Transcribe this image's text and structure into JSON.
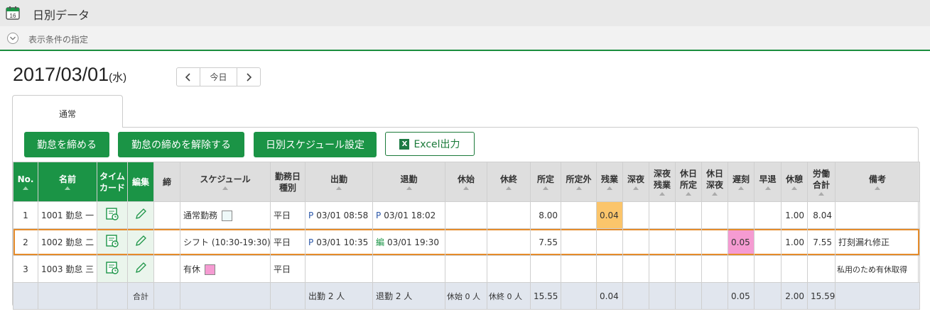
{
  "app": {
    "title": "日別データ",
    "icon": "calendar-icon",
    "icon_day": "16"
  },
  "conditions": {
    "label": "表示条件の指定"
  },
  "date": {
    "text": "2017/03/01",
    "weekday": "(水)"
  },
  "nav": {
    "prev": "‹",
    "today": "今日",
    "next": "›"
  },
  "tab": {
    "label": "通常"
  },
  "buttons": {
    "close": "勤怠を締める",
    "unclose": "勤怠の締めを解除する",
    "schedule": "日別スケジュール設定",
    "excel": "Excel出力",
    "excel_icon": "X"
  },
  "colors": {
    "accent": "#1b9446",
    "highlight_border": "#e58b2a",
    "overtime": "#fbc56b",
    "late": "#f59bd2",
    "leave": "#f59bd2"
  },
  "columns": {
    "no": "No.",
    "name": "名前",
    "timecard_1": "タイム",
    "timecard_2": "カード",
    "edit": "編集",
    "close": "締",
    "schedule": "スケジュール",
    "daytype_1": "勤務日",
    "daytype_2": "種別",
    "in": "出勤",
    "out": "退勤",
    "break_start": "休始",
    "break_end": "休終",
    "regular": "所定",
    "nonregular": "所定外",
    "overtime": "残業",
    "night": "深夜",
    "night_ot_1": "深夜",
    "night_ot_2": "残業",
    "holiday_reg_1": "休日",
    "holiday_reg_2": "所定",
    "holiday_night_1": "休日",
    "holiday_night_2": "深夜",
    "late": "遅刻",
    "early": "早退",
    "rest": "休憩",
    "total_1": "労働",
    "total_2": "合計",
    "note": "備考"
  },
  "rows": [
    {
      "no": "1",
      "name": "1001 勤怠 一",
      "schedule": "通常勤務",
      "daytype": "平日",
      "in_mark": "P",
      "in_time": "03/01 08:58",
      "out_mark": "P",
      "out_time": "03/01 18:02",
      "regular": "8.00",
      "overtime": "0.04",
      "late": "",
      "rest": "1.00",
      "total": "8.04",
      "note": ""
    },
    {
      "no": "2",
      "name": "1002 勤怠 二",
      "schedule": "シフト (10:30-19:30)",
      "daytype": "平日",
      "in_mark": "P",
      "in_time": "03/01 10:35",
      "out_mark": "編",
      "out_time": "03/01 19:30",
      "regular": "7.55",
      "overtime": "",
      "late": "0.05",
      "rest": "1.00",
      "total": "7.55",
      "note": "打刻漏れ修正"
    },
    {
      "no": "3",
      "name": "1003 勤怠 三",
      "schedule": "有休",
      "daytype": "平日",
      "in_mark": "",
      "in_time": "",
      "out_mark": "",
      "out_time": "",
      "regular": "",
      "overtime": "",
      "late": "",
      "rest": "",
      "total": "",
      "note": "私用のため有休取得"
    }
  ],
  "totals": {
    "label": "合計",
    "in": "出勤 2 人",
    "out": "退勤 2 人",
    "break_start": "休始 0 人",
    "break_end": "休終 0 人",
    "regular": "15.55",
    "overtime": "0.04",
    "late": "0.05",
    "rest": "2.00",
    "total": "15.59"
  }
}
